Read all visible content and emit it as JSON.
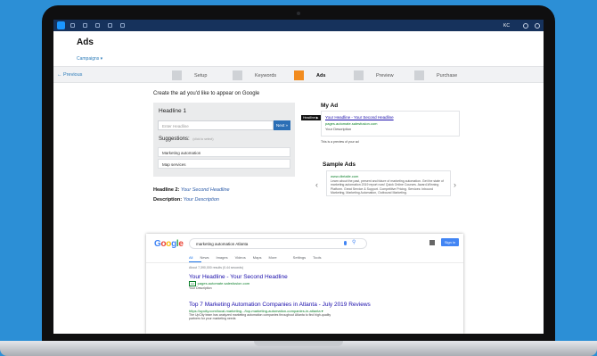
{
  "app": {
    "title": "Ads",
    "breadcrumb": "Campaigns ▾",
    "user_initials": "KC",
    "top_icons": [
      "grid-icon",
      "calendar-icon",
      "people-icon",
      "table-icon",
      "clock-icon"
    ]
  },
  "wizard": {
    "previous_label": "← Previous",
    "steps": [
      {
        "label": "Setup",
        "active": false
      },
      {
        "label": "Keywords",
        "active": false
      },
      {
        "label": "Ads",
        "active": true
      },
      {
        "label": "Preview",
        "active": false
      },
      {
        "label": "Purchase",
        "active": false
      }
    ]
  },
  "editor": {
    "heading": "Create the ad you'd like to appear on Google",
    "headline_label": "Headline 1",
    "headline_placeholder": "Enter Headline",
    "next_label": "Next »",
    "suggestions_label": "Suggestions:",
    "suggestions_hint": "(click to select)",
    "suggestions": [
      "Marketing automation",
      "Map services"
    ],
    "headline2_label": "Headline 2:",
    "headline2_value": "Your Second Headline",
    "description_label": "Description:",
    "description_value": "Your Description"
  },
  "my_ad": {
    "title": "My Ad",
    "headline_tag": "Headline ▶",
    "ad_title": "Your Headline - Your Second Headline",
    "ad_url": "pages.automate.salesfusion.com",
    "ad_desc": "Your Description",
    "preview_note": "This is a preview of your ad"
  },
  "sample_ads": {
    "title": "Sample Ads",
    "url": "www.dbrtaile.com",
    "desc": "Learn about the past, present and future of marketing automation. Get the state of marketing automation 2019 report now! Quick Online Courses. Award-Winning Platform. Great Service & Support. Competitive Pricing. Services: Inbound Marketing, Marketing Automation, Outbound Marketing."
  },
  "google": {
    "logo_letters": [
      "G",
      "o",
      "o",
      "g",
      "l",
      "e"
    ],
    "query": "marketing automation Atlanta",
    "signin_label": "Sign in",
    "tabs": [
      "All",
      "News",
      "Images",
      "Videos",
      "Maps",
      "More"
    ],
    "settings_label": "Settings",
    "tools_label": "Tools",
    "stats": "About 7,390,000 results (0.44 seconds)",
    "result1_title": "Your Headline - Your Second Headline",
    "result1_ad_badge": "Ad",
    "result1_url": "pages.automate.salesfusion.com",
    "result1_desc": "Your Description",
    "result2_title": "Top 7 Marketing Automation Companies in Atlanta - July 2019 Reviews",
    "result2_url": "https://upcity.com/local-marketing.../top-marketing-automation-companies-in-atlanta ▾",
    "result2_desc": "The UpCity team has analyzed marketing automation companies throughout Atlanta to find high-quality partners for your marketing needs"
  },
  "colors": {
    "background": "#2c8fd6",
    "topbar": "#16325c",
    "active_step": "#f28c1f",
    "link": "#1a0dab",
    "url_green": "#0a7f2a",
    "google_blue": "#4285f4"
  }
}
